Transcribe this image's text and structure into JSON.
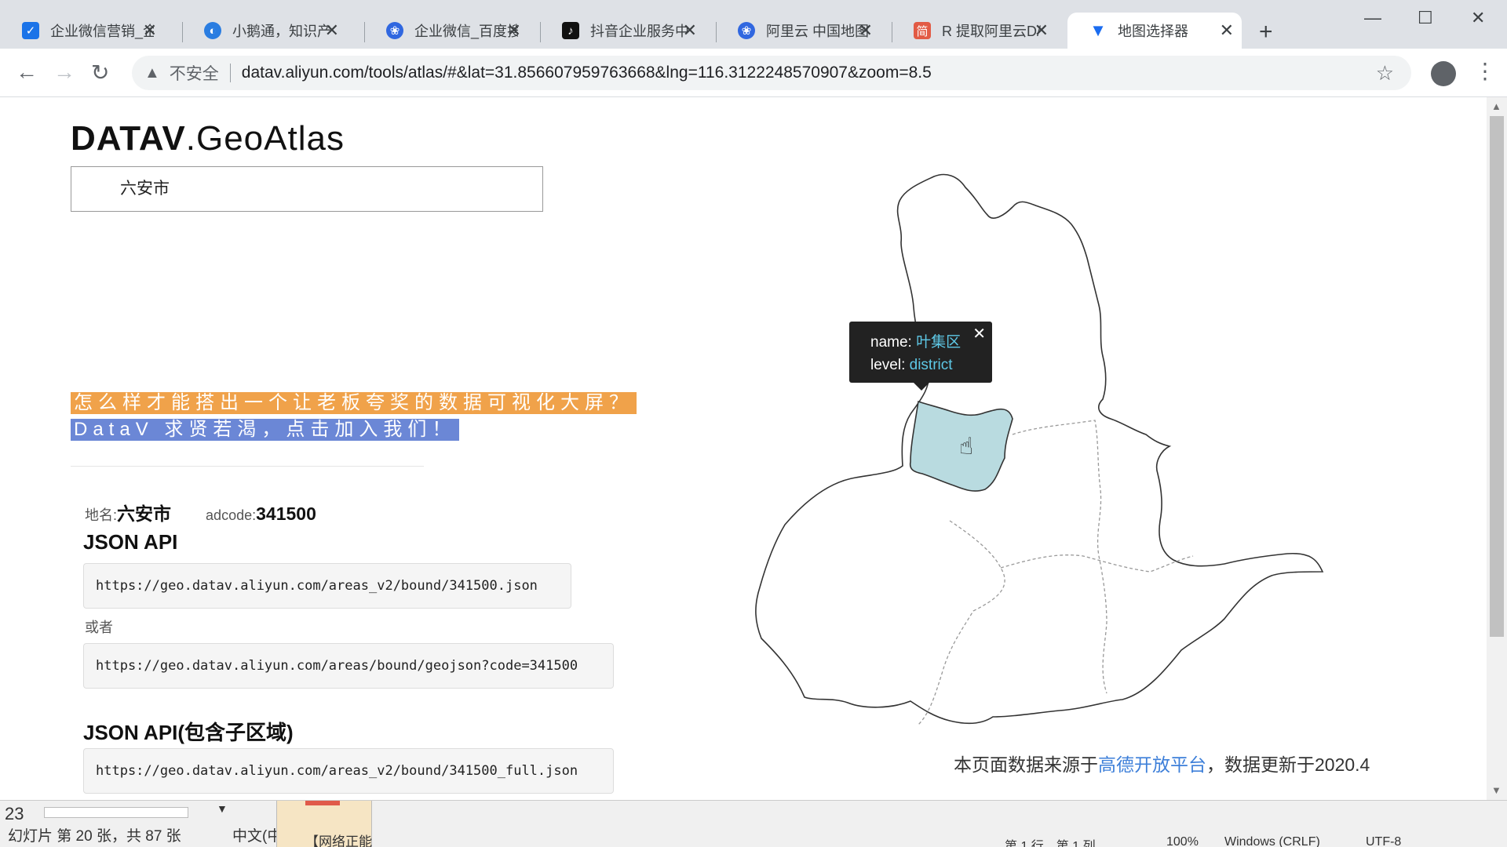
{
  "browser": {
    "tabs": [
      {
        "title": "企业微信营销_企",
        "icon": "check-icon",
        "color": "#1a73e8"
      },
      {
        "title": "小鹅通，知识产",
        "icon": "swirl-icon",
        "color": "#2a7de1"
      },
      {
        "title": "企业微信_百度搜",
        "icon": "paw-icon",
        "color": "#3067e0"
      },
      {
        "title": "抖音企业服务中",
        "icon": "tiktok-icon",
        "color": "#111111"
      },
      {
        "title": "阿里云 中国地图",
        "icon": "paw-icon",
        "color": "#3067e0"
      },
      {
        "title": "R 提取阿里云D/",
        "icon": "jian-icon",
        "color": "#e25b45"
      },
      {
        "title": "地图选择器",
        "icon": "datav-icon",
        "color": "#1a6cf0",
        "active": true
      }
    ],
    "address": {
      "security_label": "不安全",
      "url": "datav.aliyun.com/tools/atlas/#&lat=31.856607959763668&lng=116.3122248570907&zoom=8.5"
    }
  },
  "page": {
    "logo_bold": "DATAV",
    "logo_rest": ".GeoAtlas",
    "search_value": "六安市",
    "banner_line1": "怎么样才能搭出一个让老板夸奖的数据可视化大屏？",
    "banner_line2": "DataV 求贤若渴，点击加入我们！",
    "place_label": "地名:",
    "place_value": "六安市",
    "adcode_label": "adcode:",
    "adcode_value": "341500",
    "json_api_title": "JSON API",
    "json_api_url": "https://geo.datav.aliyun.com/areas_v2/bound/341500.json",
    "or_label": "或者",
    "json_api_url_alt": "https://geo.datav.aliyun.com/areas/bound/geojson?code=341500",
    "json_api_sub_title": "JSON API(包含子区域)",
    "json_api_sub_url": "https://geo.datav.aliyun.com/areas_v2/bound/341500_full.json",
    "tooltip": {
      "name_label": "name:",
      "name_value": "叶集区",
      "level_label": "level:",
      "level_value": "district"
    },
    "footer_prefix": "本页面数据来源于",
    "footer_link": "高德开放平台",
    "footer_suffix": "，数据更新于2020.4",
    "highlight_color": "#b9dbe0"
  },
  "bottom_bar": {
    "slide_number": "23",
    "status_text": "幻灯片 第 20 张，共 87 张",
    "language": "中文(中",
    "network_text": "【网络正能",
    "right_status": [
      "第 1 行，第 1 列",
      "100%",
      "Windows (CRLF)",
      "UTF-8"
    ]
  }
}
